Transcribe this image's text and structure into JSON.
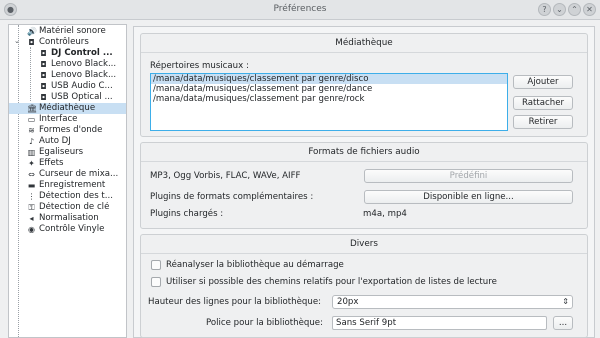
{
  "window": {
    "title": "Préférences"
  },
  "titlebar": {
    "help_glyph": "?",
    "min_glyph": "⌄",
    "max_glyph": "⌃",
    "close_glyph": "✕",
    "menu_glyph": "●"
  },
  "sidebar": {
    "items": [
      {
        "label": "Matériel sonore",
        "icon": "speaker-icon",
        "glyph": "🔊"
      },
      {
        "label": "Contrôleurs",
        "icon": "controller-icon",
        "glyph": "◘"
      },
      {
        "label": "DJ Control ...",
        "icon": "controller-icon",
        "glyph": "◘"
      },
      {
        "label": "Lenovo Black...",
        "icon": "controller-icon",
        "glyph": "◘"
      },
      {
        "label": "Lenovo Black...",
        "icon": "controller-icon",
        "glyph": "◘"
      },
      {
        "label": "USB Audio C...",
        "icon": "controller-icon",
        "glyph": "◘"
      },
      {
        "label": "USB Optical ...",
        "icon": "controller-icon",
        "glyph": "◘"
      },
      {
        "label": "Médiathèque",
        "icon": "library-icon",
        "glyph": "🏛"
      },
      {
        "label": "Interface",
        "icon": "monitor-icon",
        "glyph": "▭"
      },
      {
        "label": "Formes d'onde",
        "icon": "waveform-icon",
        "glyph": "≋"
      },
      {
        "label": "Auto DJ",
        "icon": "autodj-icon",
        "glyph": "♪"
      },
      {
        "label": "Égaliseurs",
        "icon": "equalizer-icon",
        "glyph": "▥"
      },
      {
        "label": "Effets",
        "icon": "effects-icon",
        "glyph": "✦"
      },
      {
        "label": "Curseur de mixa...",
        "icon": "crossfader-icon",
        "glyph": "⇔"
      },
      {
        "label": "Enregistrement",
        "icon": "record-icon",
        "glyph": "▬"
      },
      {
        "label": "Détection des t...",
        "icon": "bpm-icon",
        "glyph": "⋮"
      },
      {
        "label": "Détection de clé",
        "icon": "key-icon",
        "glyph": "⚿"
      },
      {
        "label": "Normalisation",
        "icon": "normalization-icon",
        "glyph": "◂"
      },
      {
        "label": "Contrôle Vinyle",
        "icon": "vinyl-icon",
        "glyph": "◉"
      }
    ]
  },
  "mediatheque": {
    "title": "Médiathèque",
    "dirs_label": "Répertoires musicaux :",
    "dirs": [
      "/mana/data/musiques/classement par genre/disco",
      "/mana/data/musiques/classement par genre/dance",
      "/mana/data/musiques/classement par genre/rock"
    ],
    "add_button": "Ajouter",
    "relink_button": "Rattacher",
    "remove_button": "Retirer"
  },
  "formats": {
    "title": "Formats de fichiers audio",
    "builtin_label": "MP3, Ogg Vorbis, FLAC, WAVe, AIFF",
    "builtin_button": "Prédéfini",
    "plugins_label": "Plugins de formats complémentaires :",
    "plugins_button": "Disponible en ligne...",
    "loaded_label": "Plugins chargés :",
    "loaded_value": "m4a, mp4"
  },
  "divers": {
    "title": "Divers",
    "rescan_label": "Réanalyser la bibliothèque au démarrage",
    "relative_label": "Utiliser si possible des chemins relatifs pour l'exportation de listes de lecture",
    "row_height_label": "Hauteur des lignes pour la bibliothèque:",
    "row_height_value": "20px",
    "font_label": "Police pour la bibliothèque:",
    "font_value": "Sans Serif  9pt",
    "font_button": "..."
  }
}
